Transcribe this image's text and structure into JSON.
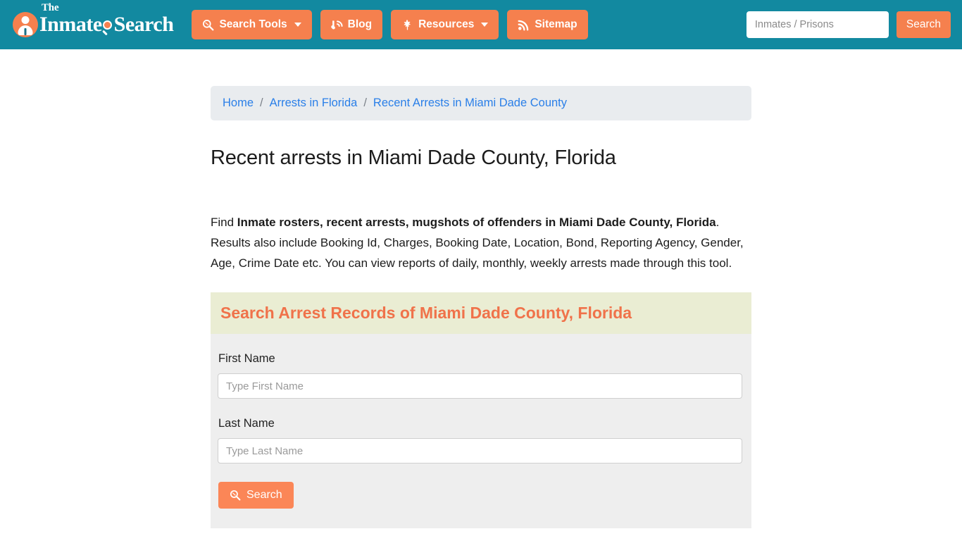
{
  "header": {
    "brand": {
      "the": "The",
      "word1": "Inmate",
      "word2": "Search",
      "person_icon": "person-circle-icon",
      "magnifier_icon": "magnifier-icon"
    },
    "nav_buttons": [
      {
        "label": "Search Tools",
        "icon": "magnifier-icon",
        "has_caret": true
      },
      {
        "label": "Blog",
        "icon": "blog-icon",
        "has_caret": false
      },
      {
        "label": "Resources",
        "icon": "leaf-icon",
        "has_caret": true
      },
      {
        "label": "Sitemap",
        "icon": "rss-icon",
        "has_caret": false
      }
    ],
    "search": {
      "placeholder": "Inmates / Prisons",
      "value": "",
      "button_label": "Search"
    }
  },
  "breadcrumb": {
    "items": [
      {
        "label": "Home"
      },
      {
        "label": "Arrests in Florida"
      },
      {
        "label": "Recent Arrests in Miami Dade County"
      }
    ],
    "separator": "/"
  },
  "main": {
    "page_title": "Recent arrests in Miami Dade County, Florida",
    "intro": {
      "lead": "Find ",
      "bold": "Inmate rosters, recent arrests, mugshots of offenders in Miami Dade County, Florida",
      "rest": ". Results also include Booking Id, Charges, Booking Date, Location, Bond, Reporting Agency, Gender, Age, Crime Date etc. You can view reports of daily, monthly, weekly arrests made through this tool."
    },
    "section_heading": "Search Arrest Records of Miami Dade County, Florida",
    "form": {
      "first_name": {
        "label": "First Name",
        "placeholder": "Type First Name",
        "value": ""
      },
      "last_name": {
        "label": "Last Name",
        "placeholder": "Type Last Name",
        "value": ""
      },
      "submit": {
        "label": "Search",
        "icon": "magnifier-icon"
      }
    }
  },
  "colors": {
    "header_teal": "#1289a0",
    "accent_orange": "#f5804e",
    "breadcrumb_bg": "#e9ecef",
    "breadcrumb_link": "#2a7fe8",
    "section_bg": "#eaedd3",
    "section_text": "#f0724a",
    "form_bg": "#eeeeee"
  }
}
